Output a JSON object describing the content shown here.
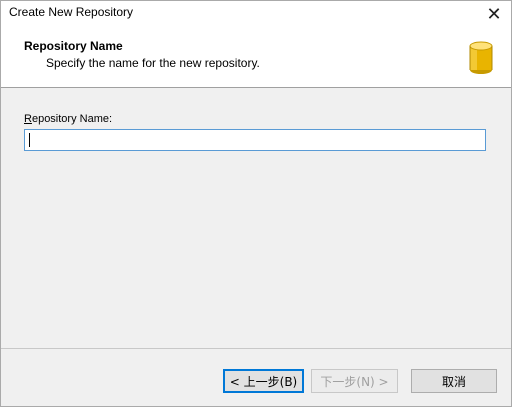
{
  "window": {
    "title": "Create New Repository",
    "close_glyph": "✕"
  },
  "header": {
    "title": "Repository Name",
    "subtitle": "Specify the name for the new repository.",
    "icon": "database-icon",
    "icon_color": "#f0c419"
  },
  "form": {
    "label_accel": "R",
    "label_rest": "epository Name:",
    "repository_name_value": ""
  },
  "buttons": {
    "back_label": "< 上一步(B)",
    "next_label": "下一步(N) >",
    "cancel_label": "取消"
  },
  "colors": {
    "accent": "#0078d7",
    "input_border": "#5a9bd5"
  }
}
